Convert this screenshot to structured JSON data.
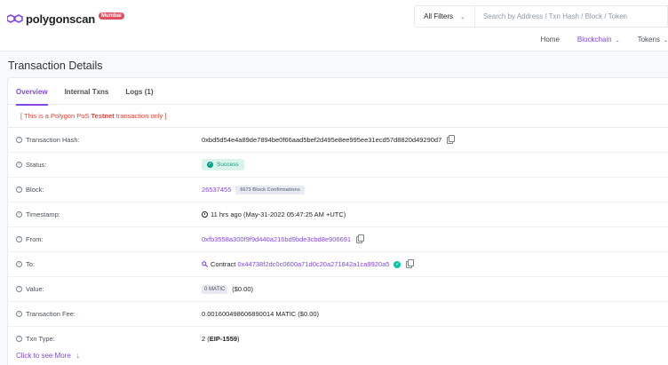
{
  "header": {
    "logo_text": "polygonscan",
    "network_badge": "Mumbai",
    "filter_label": "All Filters",
    "search_placeholder": "Search by Address / Txn Hash / Block / Token",
    "nav": {
      "home": "Home",
      "blockchain": "Blockchain",
      "tokens": "Tokens"
    }
  },
  "page_title": "Transaction Details",
  "tabs": {
    "overview": "Overview",
    "internal": "Internal Txns",
    "logs": "Logs (1)"
  },
  "note": {
    "prefix": "[ This is a Polygon PoS ",
    "emph": "Testnet",
    "suffix": " transaction only ]"
  },
  "rows": {
    "hash": {
      "label": "Transaction Hash:",
      "value": "0xbd5d54e4a89de7894be0f66aad5bef2d495e8ee995ee31ecd57d8820d49290d7"
    },
    "status": {
      "label": "Status:",
      "value": "Success"
    },
    "block": {
      "label": "Block:",
      "value": "26537455",
      "confirmations": "6673 Block Confirmations"
    },
    "timestamp": {
      "label": "Timestamp:",
      "value": "11 hrs ago (May-31-2022 05:47:25 AM +UTC)"
    },
    "from": {
      "label": "From:",
      "value": "0xfb3558a300f9f9d440a216bd9bde3cbd8e906691"
    },
    "to": {
      "label": "To:",
      "prefix": "Contract",
      "value": "0x44738f2dc0c0600a71d0c20a271842a1ca9920a5"
    },
    "value": {
      "label": "Value:",
      "amount": "0 MATIC",
      "usd": "($0.00)"
    },
    "fee": {
      "label": "Transaction Fee:",
      "value": "0.001600498606890014 MATIC ($0.00)"
    },
    "txn_type": {
      "label": "Txn Type:",
      "num": "2 (",
      "type": "EIP-1559",
      "close": ")"
    }
  },
  "see_more": "Click to see More",
  "colors": {
    "accent": "#8247e5",
    "success": "#00a186",
    "testnet_red": "#de4437"
  }
}
